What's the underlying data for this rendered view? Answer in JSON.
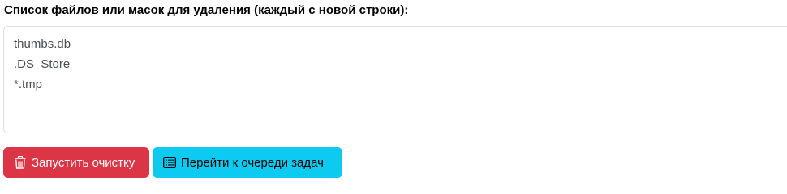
{
  "form": {
    "label": "Список файлов или масок для удаления (каждый с новой строки):",
    "lines": [
      "thumbs.db",
      ".DS_Store",
      "*.tmp"
    ]
  },
  "buttons": {
    "cleanup": {
      "label": "Запустить очистку",
      "icon": "trash-icon",
      "color": "#dc3545"
    },
    "queue": {
      "label": "Перейти к очереди задач",
      "icon": "list-icon",
      "color": "#0dcaf0"
    }
  }
}
